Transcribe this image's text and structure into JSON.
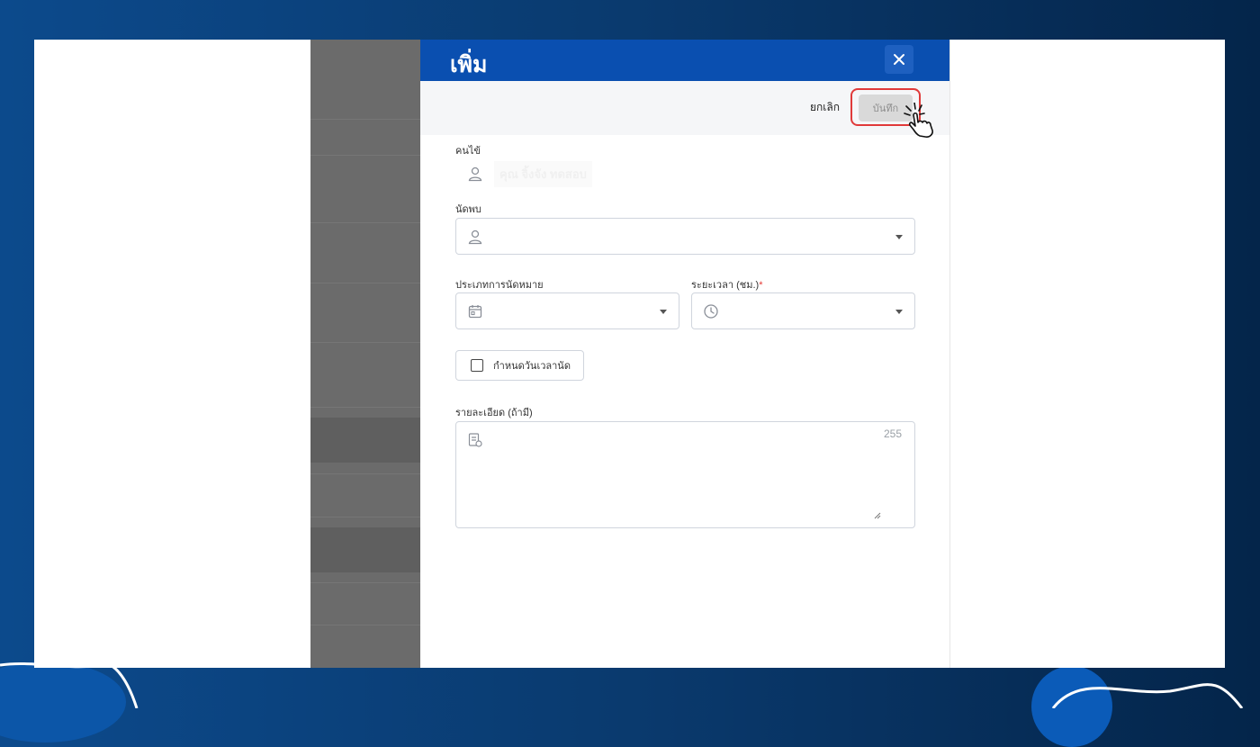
{
  "drawer": {
    "title": "เพิ่ม",
    "close_icon": "close-icon"
  },
  "toolbar": {
    "cancel_label": "ยกเลิก",
    "save_label": "บันทึก"
  },
  "form": {
    "host_label": "คนไข้",
    "host_value": "คุณ จิ้งจัง ทดสอบ",
    "meet_label": "นัดพบ",
    "meet_value": "",
    "appointment_type_label": "ประเภทการนัดหมาย",
    "appointment_type_value": "",
    "duration_label": "ระยะเวลา (ชม.)",
    "duration_required": "*",
    "duration_value": "",
    "set_datetime_label": "กำหนดวันเวลานัด",
    "details_label": "รายละเอียด (ถ้ามี)",
    "details_value": "",
    "details_counter": "255"
  },
  "colors": {
    "header_blue": "#0a4fb0",
    "highlight_red": "#e03a3a",
    "overlay_gray": "#6b6b6b"
  }
}
